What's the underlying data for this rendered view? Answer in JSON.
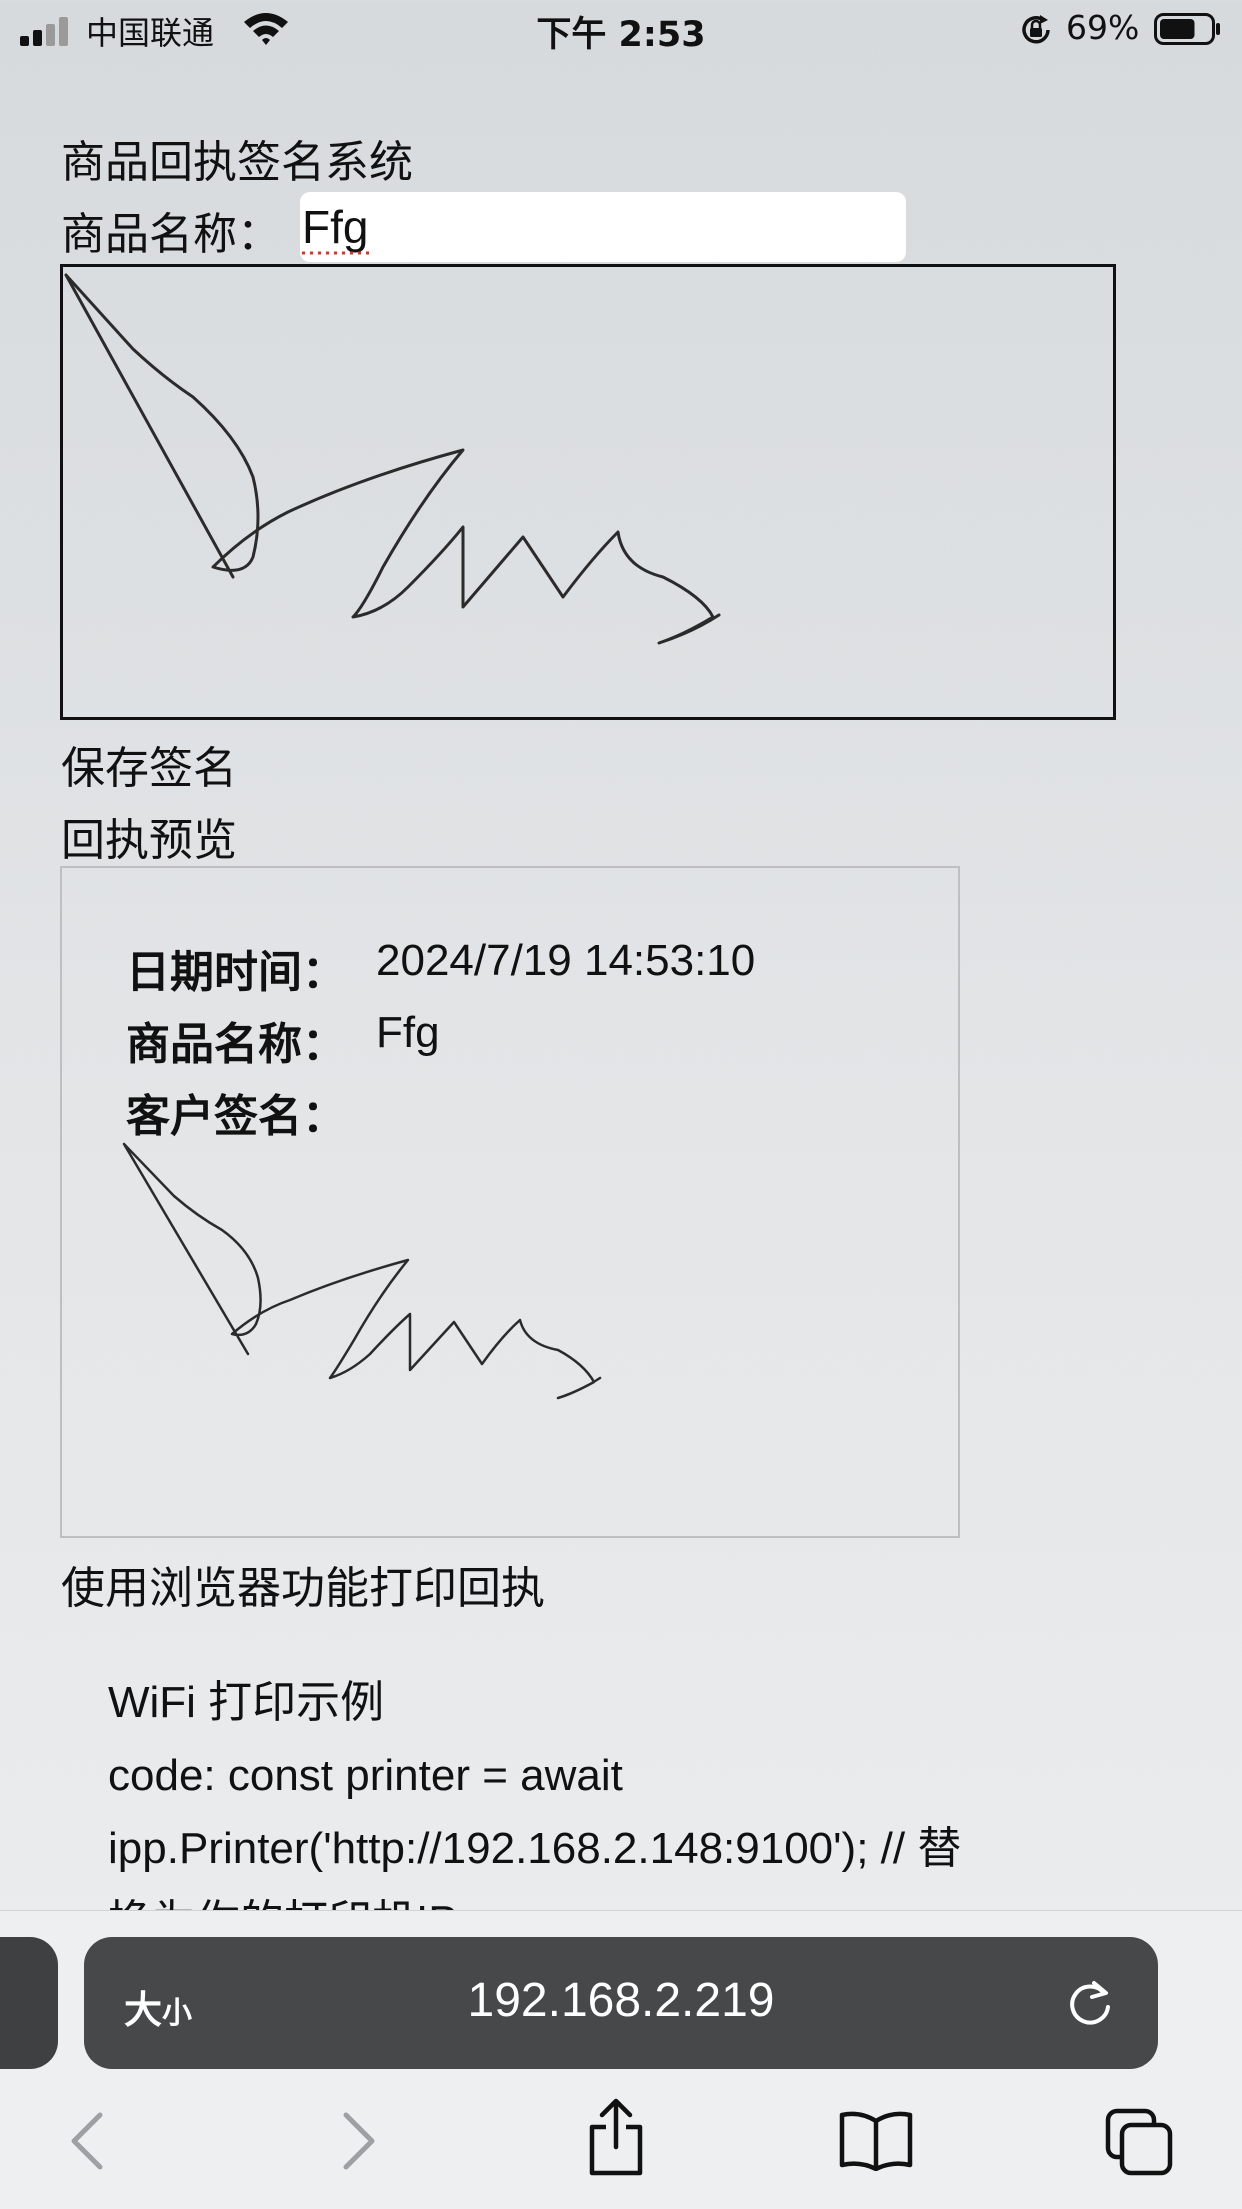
{
  "status_bar": {
    "carrier": "中国联通",
    "time": "下午 2:53",
    "battery_percent": "69%",
    "battery_level": 0.69
  },
  "page": {
    "title": "商品回执签名系统",
    "product_label": "商品名称：",
    "product_value": "Ffg",
    "save_signature": "保存签名",
    "preview_title": "回执预览",
    "preview": {
      "datetime_label": "日期时间：",
      "datetime_value": "2024/7/19 14:53:10",
      "product_label": "商品名称：",
      "product_value": "Ffg",
      "signature_label": "客户签名："
    },
    "print_link": "使用浏览器功能打印回执",
    "code_lines": [
      "WiFi 打印示例",
      "code: const printer = await",
      "ipp.Printer('http://192.168.2.148:9100'); // 替",
      "换为你的打印机IP"
    ]
  },
  "toolbar": {
    "size_label_big": "大",
    "size_label_small": "小",
    "url": "192.168.2.219",
    "icons": [
      "back-icon",
      "forward-icon",
      "share-icon",
      "bookmarks-icon",
      "tabs-icon",
      "reload-icon"
    ]
  }
}
